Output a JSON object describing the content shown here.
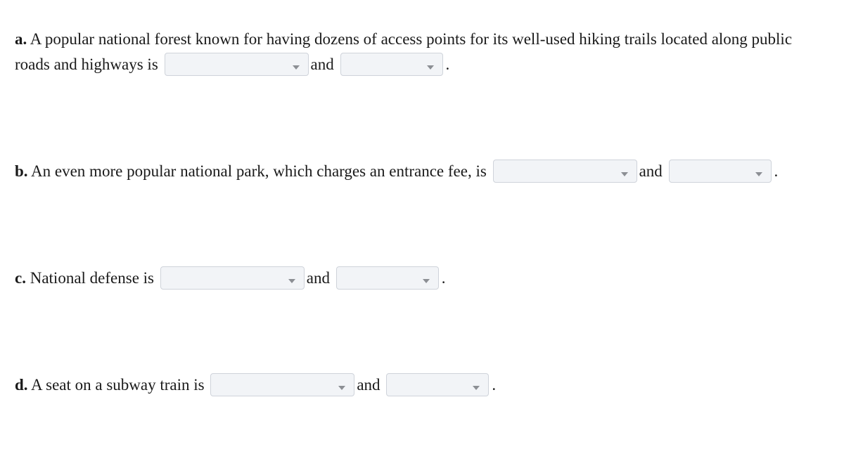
{
  "questions": [
    {
      "label": "a.",
      "text_line1": " A popular national forest known for having dozens of access points for its well-used hiking trails located along public",
      "text_line2": "roads and highways is",
      "connector": "and",
      "end": ".",
      "dropdown1": {
        "selected": ""
      },
      "dropdown2": {
        "selected": ""
      }
    },
    {
      "label": "b.",
      "text": " An even more popular national park, which charges an entrance fee, is",
      "connector": "and",
      "end": ".",
      "dropdown1": {
        "selected": ""
      },
      "dropdown2": {
        "selected": ""
      }
    },
    {
      "label": "c.",
      "text": " National defense is",
      "connector": "and",
      "end": ".",
      "dropdown1": {
        "selected": ""
      },
      "dropdown2": {
        "selected": ""
      }
    },
    {
      "label": "d.",
      "text": " A seat on a subway train is",
      "connector": "and",
      "end": ".",
      "dropdown1": {
        "selected": ""
      },
      "dropdown2": {
        "selected": ""
      }
    }
  ],
  "icons": {
    "dropdown_caret": "chevron-down-icon"
  }
}
